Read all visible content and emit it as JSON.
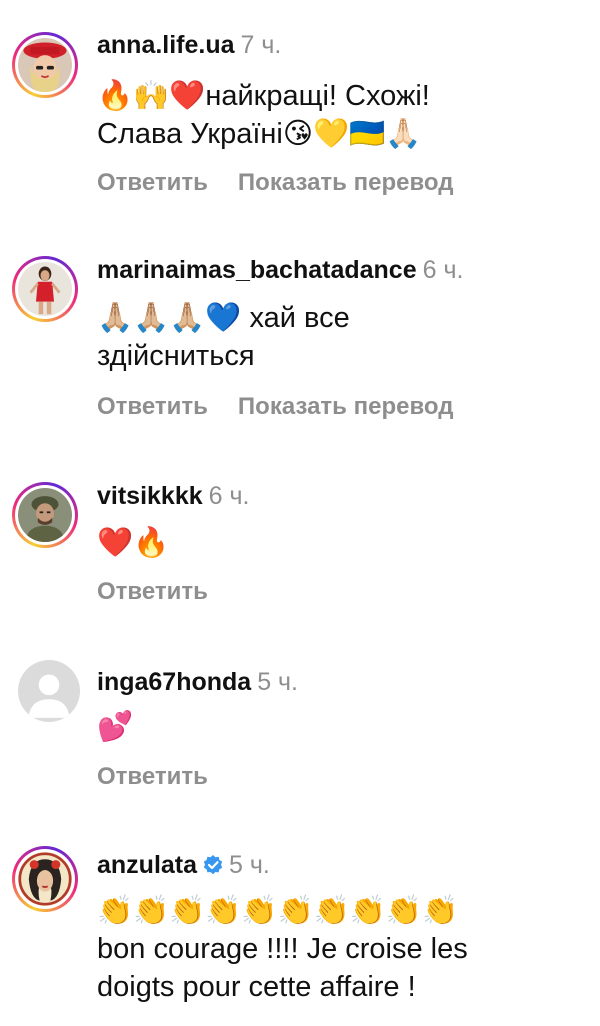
{
  "colors": {
    "username": "#111111",
    "meta": "#8e8e8e",
    "verified_badge": "#3897f0",
    "story_ring": [
      "#f9ce34",
      "#ee2a7b",
      "#6228d7"
    ]
  },
  "comments": [
    {
      "username": "anna.life.ua",
      "time": "7 ч.",
      "text": "🔥🙌❤️найкращі! Схожі!\nСлава Україні😘💛🇺🇦🙏🏻",
      "reply_label": "Ответить",
      "translate_label": "Показать перевод",
      "avatar_icon": "woman-red-hat-avatar"
    },
    {
      "username": "marinaimas_bachatadance",
      "time": "6 ч.",
      "text": "🙏🏼🙏🏼🙏🏼💙 хай все\nздійсниться",
      "reply_label": "Ответить",
      "translate_label": "Показать перевод",
      "avatar_icon": "woman-red-dress-avatar"
    },
    {
      "username": "vitsikkkk",
      "time": "6 ч.",
      "text": "❤️🔥",
      "reply_label": "Ответить",
      "avatar_icon": "soldier-avatar"
    },
    {
      "username": "inga67honda",
      "time": "5 ч.",
      "text": "💕",
      "reply_label": "Ответить",
      "avatar_icon": "default-user-avatar"
    },
    {
      "username": "anzulata",
      "verified": true,
      "time": "5 ч.",
      "text": "👏👏👏👏👏👏👏👏👏👏\nbon courage !!!! Je croise les\ndoigts pour cette affaire !",
      "avatar_icon": "illustrated-woman-avatar"
    }
  ]
}
